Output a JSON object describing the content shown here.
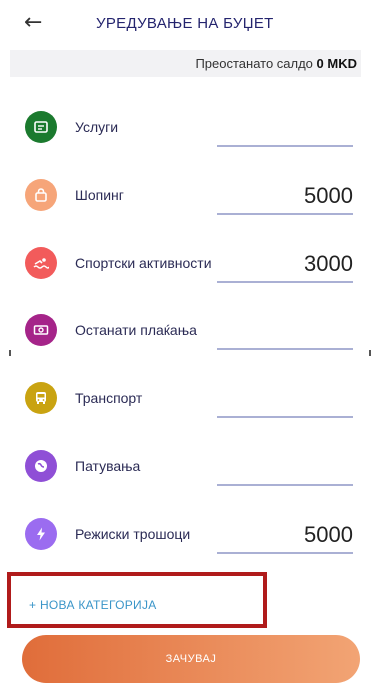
{
  "header": {
    "back_icon": "arrow-left-icon",
    "title": "УРЕДУВАЊЕ НА БУЏЕТ"
  },
  "balance": {
    "label": "Преостанато салдо",
    "value": "0 MKD"
  },
  "categories": [
    {
      "label": "Услуги",
      "amount": "",
      "icon": "receipt-icon",
      "color": "#1b7a2e"
    },
    {
      "label": "Шопинг",
      "amount": "5000",
      "icon": "shopping-bag-icon",
      "color": "#f6a579"
    },
    {
      "label": "Спортски активности",
      "amount": "3000",
      "icon": "swimming-icon",
      "color": "#f25b5b"
    },
    {
      "label": "Останати плаќања",
      "amount": "",
      "icon": "banknote-icon",
      "color": "#a52489"
    },
    {
      "label": "Транспорт",
      "amount": "",
      "icon": "bus-icon",
      "color": "#c9a311"
    },
    {
      "label": "Патувања",
      "amount": "",
      "icon": "globe-icon",
      "color": "#8f4fd6"
    },
    {
      "label": "Режиски трошоци",
      "amount": "5000",
      "icon": "lightning-icon",
      "color": "#9b6cf0"
    }
  ],
  "new_category": {
    "label": "+ НОВА КАТЕГОРИЈА"
  },
  "save": {
    "label": "ЗАЧУВАЈ"
  },
  "accent_colors": {
    "highlight": "#b01b1b",
    "link": "#3a95c8",
    "button_start": "#e06d3a",
    "button_end": "#f2a474"
  }
}
